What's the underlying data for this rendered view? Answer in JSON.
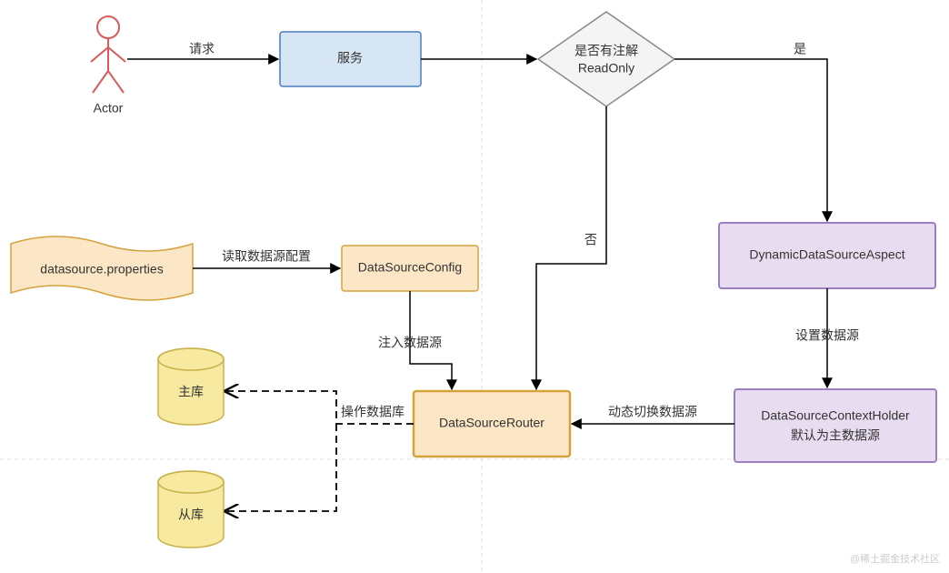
{
  "nodes": {
    "actor": {
      "label": "Actor"
    },
    "service": {
      "label": "服务"
    },
    "decision": {
      "line1": "是否有注解",
      "line2": "ReadOnly"
    },
    "properties": {
      "label": "datasource.properties"
    },
    "config": {
      "label": "DataSourceConfig"
    },
    "router": {
      "label": "DataSourceRouter"
    },
    "aspect": {
      "label": "DynamicDataSourceAspect"
    },
    "holder": {
      "line1": "DataSourceContextHolder",
      "line2": "默认为主数据源"
    },
    "master": {
      "label": "主库"
    },
    "slave": {
      "label": "从库"
    }
  },
  "edges": {
    "request": "请求",
    "yes": "是",
    "no": "否",
    "readConfig": "读取数据源配置",
    "inject": "注入数据源",
    "setDs": "设置数据源",
    "switchDs": "动态切换数据源",
    "operateDb": "操作数据库"
  },
  "watermark": "@稀土掘金技术社区"
}
